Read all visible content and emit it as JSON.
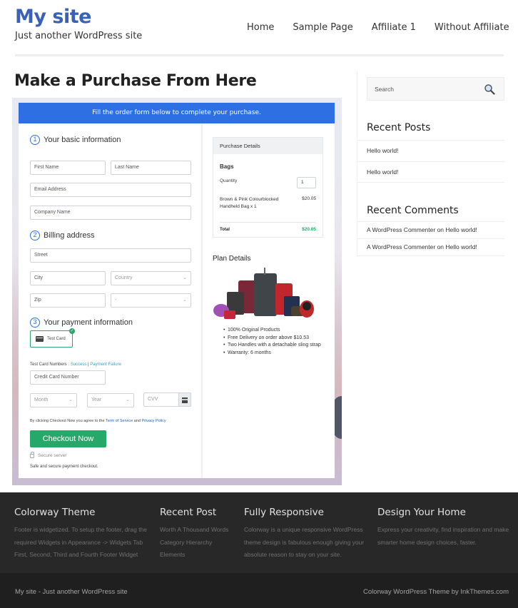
{
  "site": {
    "title": "My site",
    "tagline": "Just another WordPress site",
    "brand_color": "#3a61b8"
  },
  "nav": {
    "items": [
      "Home",
      "Sample Page",
      "Affiliate 1",
      "Without Affiliate"
    ]
  },
  "page": {
    "title": "Make a Purchase From Here"
  },
  "checkout_form": {
    "banner": "Fill the order form below to complete your purchase.",
    "banner_color": "#2f6fe4",
    "steps": [
      {
        "num": "1",
        "title": "Your basic information"
      },
      {
        "num": "2",
        "title": "Billing address"
      },
      {
        "num": "3",
        "title": "Your payment information"
      }
    ],
    "fields": {
      "first_name": "First Name",
      "last_name": "Last Name",
      "email": "Email Address",
      "company": "Company Name",
      "street": "Street",
      "city": "City",
      "country": "Country",
      "zip": "Zip",
      "state": "-",
      "card_number": "Credit Card Number",
      "month": "Month",
      "year": "Year",
      "cvv": "CVV"
    },
    "payment_method": "Test Card",
    "test_cards": {
      "label": "Test Card Numbers : ",
      "success": "Success",
      "separator": " | ",
      "failure": "Payment Failure"
    },
    "terms": {
      "prefix": "By clicking Checkout Now you agree to the ",
      "tos": "Term of Service",
      "and": " and ",
      "privacy": "Privacy Policy"
    },
    "checkout_button": "Checkout Now",
    "checkout_color": "#25a86a",
    "secure_server": "Secure server",
    "safe_text": "Safe and secure payment checkout."
  },
  "purchase_details": {
    "header": "Purchase Details",
    "category": "Bags",
    "quantity_label": "Quantity",
    "quantity": "1",
    "item_name": "Brown & Pink Colourblocked Handheld Bag x 1",
    "item_price": "$20.05",
    "total_label": "Total",
    "total": "$20.05"
  },
  "plan_details": {
    "title": "Plan Details",
    "features": [
      "100% Original Products",
      "Free Delivery on order above $10.53",
      "Two Handles with a detachable sling strap",
      "Warranty: 6 months"
    ]
  },
  "sidebar": {
    "search_placeholder": "Search",
    "recent_posts_title": "Recent Posts",
    "recent_posts": [
      "Hello world!",
      "Hello world!"
    ],
    "recent_comments_title": "Recent Comments",
    "recent_comments": [
      "A WordPress Commenter on Hello world!",
      "A WordPress Commenter on Hello world!"
    ]
  },
  "footer": {
    "columns": [
      {
        "title": "Colorway Theme",
        "text": "Footer is widgetized. To setup the footer, drag the required Widgets in Appearance -> Widgets Tab First, Second, Third and Fourth Footer Widget"
      },
      {
        "title": "Recent Post",
        "links": [
          "Worth A Thousand Words",
          "Category Hierarchy",
          "Elements"
        ]
      },
      {
        "title": "Fully Responsive",
        "text": "Colorway is a unique responsive WordPress theme design is fabulous enough giving your absolute reason to stay on your site."
      },
      {
        "title": "Design Your Home",
        "text": "Express your creativity, find inspiration and make smarter home design choices, faster."
      }
    ],
    "copyright_left": "My site - Just another WordPress site",
    "copyright_right": "Colorway WordPress Theme by InkThemes.com"
  }
}
